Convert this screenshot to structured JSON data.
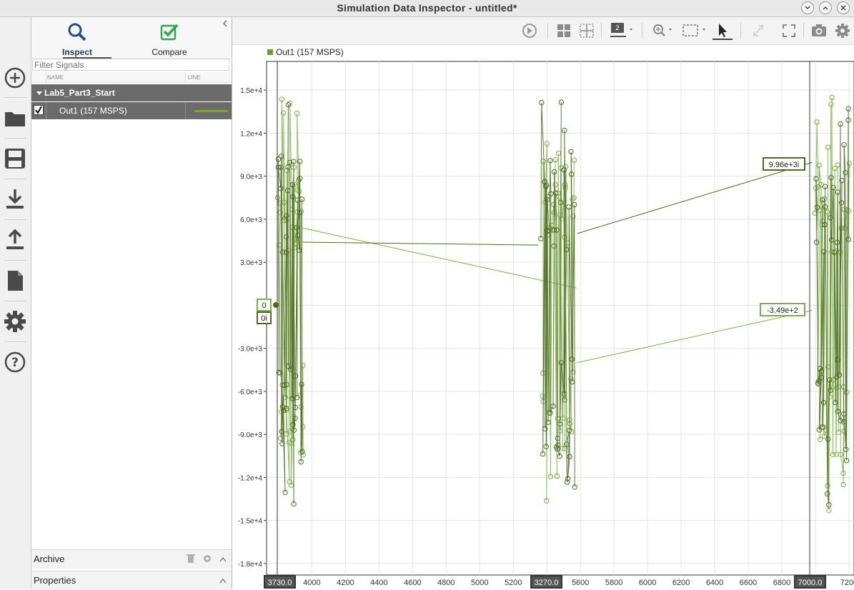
{
  "window": {
    "title": "Simulation Data Inspector - untitled*"
  },
  "left_toolbar": {
    "icons": [
      "add-icon",
      "folder-icon",
      "save-icon",
      "download-icon",
      "upload-icon",
      "document-icon",
      "gear-icon",
      "help-icon"
    ]
  },
  "panel": {
    "tabs": [
      {
        "label": "Inspect",
        "icon": "search-icon",
        "active": true
      },
      {
        "label": "Compare",
        "icon": "check-icon",
        "active": false
      }
    ],
    "filter_placeholder": "Filter Signals",
    "columns": {
      "name": "NAME",
      "line": "LINE"
    },
    "run_group": "Lab5_Part3_Start",
    "signal": {
      "name": "Out1 (157 MSPS)",
      "checked": true,
      "line_color": "#7aa728"
    },
    "archive_label": "Archive",
    "properties_label": "Properties"
  },
  "plot_toolbar": {
    "icons": [
      "replay-icon",
      "layout-grid-icon",
      "subplot-icon",
      "layout-selector-icon",
      "zoom-icon",
      "fit-icon",
      "cursor-icon",
      "expand-icon",
      "fullscreen-icon",
      "camera-icon",
      "gear-icon"
    ],
    "layout_badge": "2"
  },
  "legend": {
    "label": "Out1 (157 MSPS)",
    "color": "#6aa12c"
  },
  "chart_data": {
    "type": "line",
    "xlim": [
      3730,
      7230
    ],
    "ylim": [
      -18800,
      17000
    ],
    "x_ticks": [
      4000,
      4200,
      4400,
      4600,
      4800,
      5000,
      5200,
      5400,
      5600,
      5800,
      6000,
      6200,
      6400,
      6600,
      6800,
      7000,
      7200
    ],
    "y_ticks": [
      15000,
      12000,
      9000,
      6000,
      3000,
      0,
      -3000,
      -6000,
      -9000,
      -12000,
      -15000,
      -18000
    ],
    "y_tick_labels": [
      "1.5e+4",
      "1.2e+4",
      "9.0e+3",
      "6.0e+3",
      "3.0e+3",
      "",
      "-3.0e+3",
      "-6.0e+3",
      "-9.0e+3",
      "-1.2e+4",
      "-1.5e+4",
      "-1.8e+4"
    ],
    "grid": true,
    "series": [
      {
        "name": "Out1 (157 MSPS)",
        "component": "real",
        "color": "#78b043",
        "bursts": [
          {
            "x_start": 3800,
            "x_end": 3945
          },
          {
            "x_start": 5370,
            "x_end": 5565
          },
          {
            "x_start": 7000,
            "x_end": 7200
          }
        ],
        "connectors": [
          [
            3940,
            5400,
            5580,
            1200
          ],
          [
            5580,
            -4000,
            6980,
            -350
          ]
        ]
      },
      {
        "name": "Out1 (157 MSPS)",
        "component": "imag",
        "color": "#4d6b1f",
        "connectors": [
          [
            3945,
            4400,
            5350,
            4200
          ],
          [
            5580,
            5000,
            6980,
            9960
          ]
        ]
      }
    ],
    "cursors": {
      "left": {
        "x_label": "3730.0",
        "value_real": "0",
        "value_imag": "0i"
      },
      "middle": {
        "x_label": "3270.0"
      },
      "right": {
        "x_label": "7000.0",
        "value_real": "-3.49e+2",
        "value_imag": "9.96e+3i"
      }
    }
  }
}
